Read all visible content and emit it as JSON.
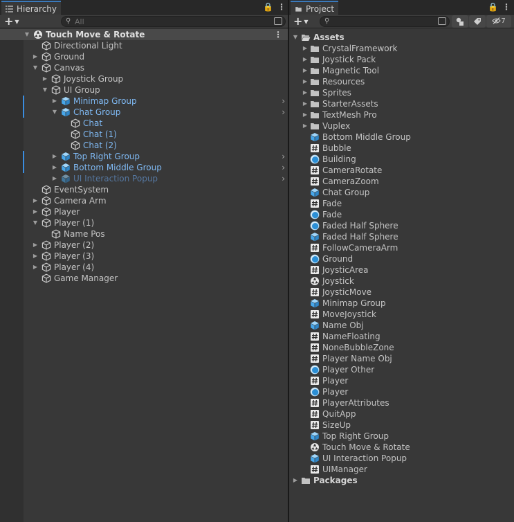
{
  "hierarchy": {
    "tab_label": "Hierarchy",
    "search_placeholder": "All",
    "scene_name": "Touch Move & Rotate",
    "items": [
      {
        "label": "Directional Light"
      },
      {
        "label": "Ground"
      },
      {
        "label": "Canvas"
      },
      {
        "label": "Joystick Group"
      },
      {
        "label": "UI Group"
      },
      {
        "label": "Minimap Group"
      },
      {
        "label": "Chat Group"
      },
      {
        "label": "Chat"
      },
      {
        "label": "Chat (1)"
      },
      {
        "label": "Chat (2)"
      },
      {
        "label": "Top Right Group"
      },
      {
        "label": "Bottom Middle Group"
      },
      {
        "label": "UI Interaction Popup"
      },
      {
        "label": "EventSystem"
      },
      {
        "label": "Camera Arm"
      },
      {
        "label": "Player"
      },
      {
        "label": "Player (1)"
      },
      {
        "label": "Name Pos"
      },
      {
        "label": "Player (2)"
      },
      {
        "label": "Player (3)"
      },
      {
        "label": "Player (4)"
      },
      {
        "label": "Game Manager"
      }
    ]
  },
  "project": {
    "tab_label": "Project",
    "hidden_count": "7",
    "assets_label": "Assets",
    "packages_label": "Packages",
    "folders": [
      {
        "label": "CrystalFramework"
      },
      {
        "label": "Joystick Pack"
      },
      {
        "label": "Magnetic Tool"
      },
      {
        "label": "Resources"
      },
      {
        "label": "Sprites"
      },
      {
        "label": "StarterAssets"
      },
      {
        "label": "TextMesh Pro"
      },
      {
        "label": "Vuplex"
      }
    ],
    "files": [
      {
        "label": "Bottom Middle Group",
        "icon": "prefab-icon"
      },
      {
        "label": "Bubble",
        "icon": "script-icon"
      },
      {
        "label": "Building",
        "icon": "material-icon"
      },
      {
        "label": "CameraRotate",
        "icon": "script-icon"
      },
      {
        "label": "CameraZoom",
        "icon": "script-icon"
      },
      {
        "label": "Chat Group",
        "icon": "prefab-icon"
      },
      {
        "label": "Fade",
        "icon": "script-icon"
      },
      {
        "label": "Fade",
        "icon": "material-icon"
      },
      {
        "label": "Faded Half Sphere",
        "icon": "material-icon"
      },
      {
        "label": "Faded Half Sphere",
        "icon": "prefab-icon"
      },
      {
        "label": "FollowCameraArm",
        "icon": "script-icon"
      },
      {
        "label": "Ground",
        "icon": "material-icon"
      },
      {
        "label": "JoysticArea",
        "icon": "script-icon"
      },
      {
        "label": "Joystick",
        "icon": "scene-icon"
      },
      {
        "label": "JoysticMove",
        "icon": "script-icon"
      },
      {
        "label": "Minimap Group",
        "icon": "prefab-icon"
      },
      {
        "label": "MoveJoystick",
        "icon": "script-icon"
      },
      {
        "label": "Name Obj",
        "icon": "prefab-icon"
      },
      {
        "label": "NameFloating",
        "icon": "script-icon"
      },
      {
        "label": "NoneBubbleZone",
        "icon": "script-icon"
      },
      {
        "label": "Player Name Obj",
        "icon": "script-icon"
      },
      {
        "label": "Player Other",
        "icon": "material-icon"
      },
      {
        "label": "Player",
        "icon": "script-icon"
      },
      {
        "label": "Player",
        "icon": "material-icon"
      },
      {
        "label": "PlayerAttributes",
        "icon": "script-icon"
      },
      {
        "label": "QuitApp",
        "icon": "script-icon"
      },
      {
        "label": "SizeUp",
        "icon": "script-icon"
      },
      {
        "label": "Top Right Group",
        "icon": "prefab-icon"
      },
      {
        "label": "Touch Move & Rotate",
        "icon": "scene-icon"
      },
      {
        "label": "UI Interaction Popup",
        "icon": "prefab-icon"
      },
      {
        "label": "UIManager",
        "icon": "script-icon"
      }
    ]
  },
  "colors": {
    "prefab_text": "#7fb9f3",
    "prefab_icon": "#5bb4f0",
    "selection_marker": "#3a8de0",
    "tab_accent": "#3a79bb"
  }
}
